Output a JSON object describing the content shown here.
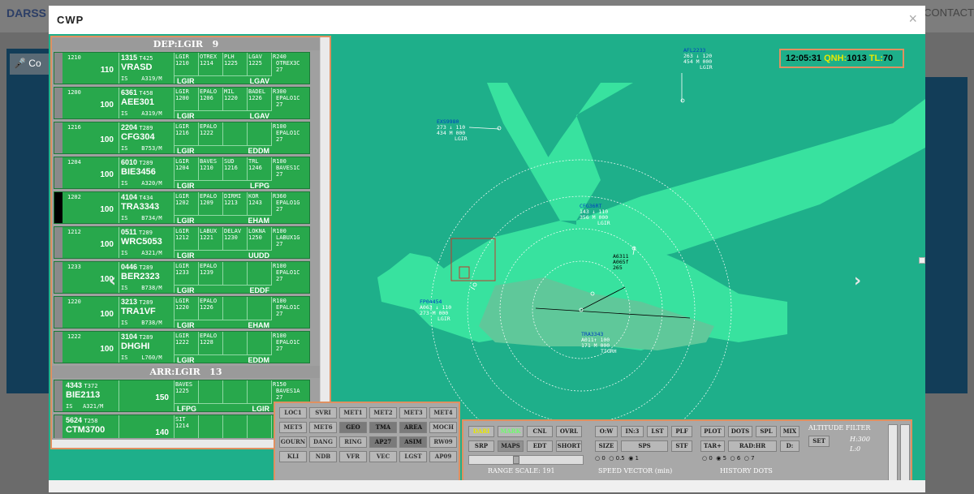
{
  "background": {
    "brand": "DARSS",
    "contact": "CONTACT",
    "left_btn": "Co"
  },
  "modal": {
    "title": "CWP",
    "close": "×"
  },
  "dep_header": {
    "label": "DEP:LGIR",
    "count": "9"
  },
  "arr_header": {
    "label": "ARR:LGIR",
    "count": "13"
  },
  "dep_strips": [
    {
      "time": "1210",
      "sq": "1315",
      "t": "T425",
      "lvl": "110",
      "cs": "VRASD",
      "rules": "IS",
      "ac": "A319/M",
      "f1": [
        "LGIR",
        "1210"
      ],
      "f2": [
        "OTREX",
        "1214"
      ],
      "f3": [
        "PLH",
        "1225"
      ],
      "f4": [
        "LGAV",
        "1225"
      ],
      "from": "LGIR",
      "to": "LGAV",
      "ex1": "R240",
      "ex2": "OTREX3C",
      "ex3": "27",
      "black": false
    },
    {
      "time": "1200",
      "sq": "6361",
      "t": "T458",
      "lvl": "100",
      "cs": "AEE301",
      "rules": "IS",
      "ac": "A319/M",
      "f1": [
        "LGIR",
        "1200"
      ],
      "f2": [
        "EPALO",
        "1206"
      ],
      "f3": [
        "MIL",
        "1220"
      ],
      "f4": [
        "BADEL",
        "1226"
      ],
      "from": "LGIR",
      "to": "LGAV",
      "ex1": "R300",
      "ex2": "EPALO1C",
      "ex3": "27",
      "black": false
    },
    {
      "time": "1216",
      "sq": "2204",
      "t": "T289",
      "lvl": "100",
      "cs": "CFG304",
      "rules": "IS",
      "ac": "B753/M",
      "f1": [
        "LGIR",
        "1216"
      ],
      "f2": [
        "EPALO",
        "1222"
      ],
      "f3": [
        "",
        ""
      ],
      "f4": [
        "",
        ""
      ],
      "from": "LGIR",
      "to": "EDDM",
      "ex1": "R100",
      "ex2": "EPALO1C",
      "ex3": "27",
      "black": false
    },
    {
      "time": "1204",
      "sq": "6010",
      "t": "T289",
      "lvl": "100",
      "cs": "BIE3456",
      "rules": "IS",
      "ac": "A320/M",
      "f1": [
        "LGIR",
        "1204"
      ],
      "f2": [
        "BAVES",
        "1210"
      ],
      "f3": [
        "SUD",
        "1216"
      ],
      "f4": [
        "TRL",
        "1246"
      ],
      "from": "LGIR",
      "to": "LFPG",
      "ex1": "R100",
      "ex2": "BAVES1C",
      "ex3": "27",
      "black": false
    },
    {
      "time": "1202",
      "sq": "4104",
      "t": "T434",
      "lvl": "100",
      "cs": "TRA3343",
      "rules": "IS",
      "ac": "B734/M",
      "f1": [
        "LGIR",
        "1202"
      ],
      "f2": [
        "EPALO",
        "1209"
      ],
      "f3": [
        "DIRMI",
        "1213"
      ],
      "f4": [
        "KOR",
        "1243"
      ],
      "from": "LGIR",
      "to": "EHAM",
      "ex1": "R360",
      "ex2": "EPALO1G",
      "ex3": "27",
      "black": true
    },
    {
      "time": "1212",
      "sq": "0511",
      "t": "T289",
      "lvl": "100",
      "cs": "WRC5053",
      "rules": "IS",
      "ac": "A321/M",
      "f1": [
        "LGIR",
        "1212"
      ],
      "f2": [
        "LABUX",
        "1221"
      ],
      "f3": [
        "DELAV",
        "1230"
      ],
      "f4": [
        "LOKNA",
        "1250"
      ],
      "from": "LGIR",
      "to": "UUDD",
      "ex1": "R100",
      "ex2": "LABUX1G",
      "ex3": "27",
      "black": false
    },
    {
      "time": "1233",
      "sq": "0446",
      "t": "T289",
      "lvl": "100",
      "cs": "BER2323",
      "rules": "IS",
      "ac": "B738/M",
      "f1": [
        "LGIR",
        "1233"
      ],
      "f2": [
        "EPALO",
        "1239"
      ],
      "f3": [
        "",
        ""
      ],
      "f4": [
        "",
        ""
      ],
      "from": "LGIR",
      "to": "EDDF",
      "ex1": "R100",
      "ex2": "EPALO1C",
      "ex3": "27",
      "black": false
    },
    {
      "time": "1220",
      "sq": "3213",
      "t": "T289",
      "lvl": "100",
      "cs": "TRA1VF",
      "rules": "IS",
      "ac": "B738/M",
      "f1": [
        "LGIR",
        "1220"
      ],
      "f2": [
        "EPALO",
        "1226"
      ],
      "f3": [
        "",
        ""
      ],
      "f4": [
        "",
        ""
      ],
      "from": "LGIR",
      "to": "EHAM",
      "ex1": "R100",
      "ex2": "EPALO1C",
      "ex3": "27",
      "black": false
    },
    {
      "time": "1222",
      "sq": "3104",
      "t": "T289",
      "lvl": "100",
      "cs": "DHGHI",
      "rules": "IS",
      "ac": "L760/M",
      "f1": [
        "LGIR",
        "1222"
      ],
      "f2": [
        "EPALO",
        "1228"
      ],
      "f3": [
        "",
        ""
      ],
      "f4": [
        "",
        ""
      ],
      "from": "LGIR",
      "to": "EDDM",
      "ex1": "R100",
      "ex2": "EPALO1C",
      "ex3": "27",
      "black": false
    }
  ],
  "arr_strips": [
    {
      "sq": "4343",
      "t": "T372",
      "cs": "BIE2113",
      "rules": "IS",
      "ac": "A321/M",
      "lvl": "150",
      "f1": [
        "BAVES",
        "1225"
      ],
      "from": "LFPG",
      "to": "LGIR",
      "ex1": "R150",
      "ex2": "BAVES1A",
      "ex3": "27"
    },
    {
      "sq": "5624",
      "t": "T258",
      "cs": "CTM3700",
      "rules": "",
      "ac": "",
      "lvl": "140",
      "f1": [
        "SIT",
        "1214"
      ],
      "from": "",
      "to": "",
      "ex1": "",
      "ex2": "",
      "ex3": ""
    }
  ],
  "clock": {
    "time": "12:05:31",
    "qnh_label": "QNH:",
    "qnh": "1013",
    "tl_label": "TL:",
    "tl": "70"
  },
  "radar_labels": [
    {
      "cs": "AFL2233",
      "l2": "263 ↓ 120",
      "l3": "454 M 000",
      "l4": "LGIR"
    },
    {
      "cs": "EXS9980",
      "l2": "273 ↓ 110",
      "l3": "434 M 000",
      "l4": "LGIR"
    },
    {
      "cs": "CFG36RT",
      "l2": "143 ↓ 110",
      "l3": "356 M 000",
      "l4": "LGIR"
    },
    {
      "cs": "A6311",
      "l2": "A065f",
      "l3": "265",
      "l4": ""
    },
    {
      "cs": "FP04454",
      "l2": "A063 ↓ 110",
      "l3": "273 M 000",
      "l4": "LGIR"
    },
    {
      "cs": "TRA3343",
      "l2": "A011↑ 100",
      "l3": "171 M 000",
      "l4": "TIGRH"
    }
  ],
  "map_buttons": [
    [
      "LOC1",
      "SVRI",
      "MET1",
      "MET2",
      "MET3",
      "MET4"
    ],
    [
      "MET5",
      "MET6",
      "GEO",
      "TMA",
      "AREA",
      "MOCH"
    ],
    [
      "GOURN",
      "DANG",
      "RING",
      "AP27",
      "ASIM",
      "RW09"
    ],
    [
      "KLI",
      "NDB",
      "VFR",
      "VEC",
      "LGST",
      "AP09"
    ]
  ],
  "map_buttons_active": [
    "GEO",
    "TMA",
    "AREA",
    "AP27",
    "ASIM"
  ],
  "tools": {
    "row1": [
      "DARI",
      "MARK",
      "CNL",
      "OVRL",
      "O:W",
      "IN:3",
      "LST",
      "PLF",
      "PLOT",
      "DOTS",
      "SPL",
      "MIX"
    ],
    "row2": [
      "SRP",
      "MAPS",
      "EDT",
      "SHORT",
      "SIZE",
      "SPS",
      "STF",
      "TAR+",
      "RAD:HR",
      "D:"
    ],
    "radios_speed": [
      "0",
      "0.5",
      "1"
    ],
    "radios_hist": [
      "0",
      "5",
      "6",
      "7"
    ],
    "range_scale": "RANGE SCALE: 191",
    "speed_vector": "SPEED VECTOR (min)",
    "history_dots": "HISTORY DOTS",
    "alt_filter": "ALTITUDE FILTER",
    "alt_set": "SET",
    "alt_h": "H:300",
    "alt_l": "L:0"
  },
  "nav": {
    "prev": "‹",
    "next": "›"
  },
  "colors": {
    "radar_bg": "#1eaf8a",
    "land": "#38e29f",
    "strip": "#28a84c",
    "accent": "#e09060"
  }
}
